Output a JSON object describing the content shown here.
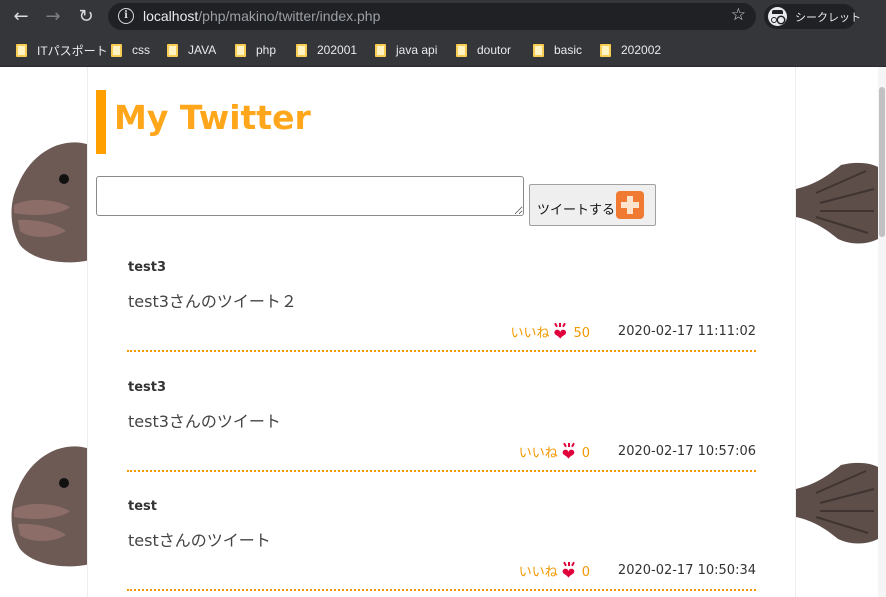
{
  "browser": {
    "nav": {
      "back_icon": "arrow-left-icon",
      "forward_icon": "arrow-right-icon",
      "reload_icon": "reload-icon"
    },
    "url_host": "localhost",
    "url_path": "/php/makino/twitter/index.php",
    "incognito_label": "シークレット",
    "bookmarks": [
      "ITパスポート",
      "css",
      "JAVA",
      "php",
      "202001",
      "java api",
      "doutor",
      "basic",
      "202002"
    ]
  },
  "page": {
    "title": "My Twitter",
    "compose": {
      "input_value": "",
      "button_label": "ツイートする"
    },
    "tweets": [
      {
        "user": "test3",
        "text": "test3さんのツイート２",
        "like_label": "いいね",
        "likes": "50",
        "date": "2020-02-17 11:11:02"
      },
      {
        "user": "test3",
        "text": "test3さんのツイート",
        "like_label": "いいね",
        "likes": "0",
        "date": "2020-02-17 10:57:06"
      },
      {
        "user": "test",
        "text": "testさんのツイート",
        "like_label": "いいね",
        "likes": "0",
        "date": "2020-02-17 10:50:34"
      }
    ]
  },
  "colors": {
    "accent": "#ffa61a",
    "accent_bar": "#ff9f00",
    "divider": "#f39800",
    "heart": "#e0003a",
    "chrome": "#35363a"
  }
}
